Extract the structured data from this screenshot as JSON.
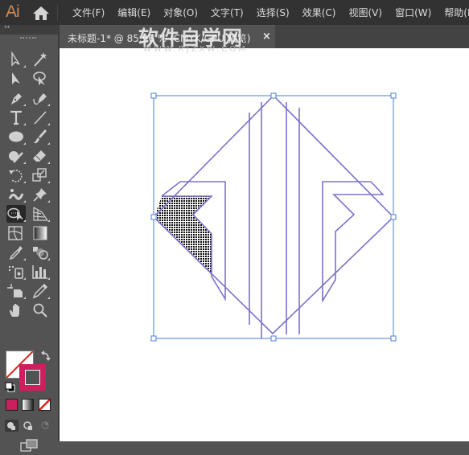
{
  "app": {
    "logo": "Ai",
    "menu": [
      "文件(F)",
      "编辑(E)",
      "对象(O)",
      "文字(T)",
      "选择(S)",
      "效果(C)",
      "视图(V)",
      "窗口(W)",
      "帮助(H)"
    ]
  },
  "document_tab": {
    "title": "未标题-1* @ 85.96 % (CMYK/GPU 预览)",
    "close_glyph": "×"
  },
  "watermark": {
    "text": "软件自学网",
    "url_text": "WWW.RJZXW.COM"
  },
  "toolbar": {
    "collapse_glyph": "‹‹",
    "tools": [
      {
        "name": "direct-selection-tool",
        "icon": "hollow-arrow-icon"
      },
      {
        "name": "magic-wand-tool",
        "icon": "magic-wand-icon"
      },
      {
        "name": "selection-tool",
        "icon": "arrow-icon"
      },
      {
        "name": "lasso-tool",
        "icon": "lasso-icon"
      },
      {
        "name": "pen-tool",
        "icon": "pen-icon"
      },
      {
        "name": "curvature-tool",
        "icon": "curvature-pen-icon"
      },
      {
        "name": "type-tool",
        "icon": "type-icon"
      },
      {
        "name": "line-segment-tool",
        "icon": "line-icon"
      },
      {
        "name": "ellipse-tool",
        "icon": "ellipse-icon"
      },
      {
        "name": "paintbrush-tool",
        "icon": "brush-icon"
      },
      {
        "name": "shaper-tool",
        "icon": "shaper-icon"
      },
      {
        "name": "eraser-tool",
        "icon": "eraser-icon"
      },
      {
        "name": "rotate-tool",
        "icon": "rotate-icon"
      },
      {
        "name": "scale-tool",
        "icon": "scale-icon"
      },
      {
        "name": "puppet-warp-tool",
        "icon": "puppet-icon"
      },
      {
        "name": "pin-tool",
        "icon": "pushpin-icon"
      },
      {
        "name": "shape-builder-tool",
        "icon": "shape-builder-icon",
        "active": true
      },
      {
        "name": "perspective-grid-tool",
        "icon": "perspective-grid-icon"
      },
      {
        "name": "mesh-tool",
        "icon": "mesh-icon"
      },
      {
        "name": "gradient-tool",
        "icon": "gradient-icon"
      },
      {
        "name": "eyedropper-tool",
        "icon": "eyedropper-icon"
      },
      {
        "name": "blend-tool",
        "icon": "blend-icon"
      },
      {
        "name": "symbol-sprayer-tool",
        "icon": "symbol-sprayer-icon"
      },
      {
        "name": "column-graph-tool",
        "icon": "bar-graph-icon"
      },
      {
        "name": "artboard-tool",
        "icon": "artboard-icon"
      },
      {
        "name": "slice-tool",
        "icon": "slice-icon"
      },
      {
        "name": "hand-tool",
        "icon": "hand-icon"
      },
      {
        "name": "zoom-tool",
        "icon": "magnifier-icon"
      }
    ],
    "fill_color": "none",
    "stroke_color": "#cc1f5d",
    "color_mode_swatch": "#cc1f5d"
  },
  "artwork": {
    "stroke_color": "#7b72c9",
    "selection_color": "#4a7fd4"
  }
}
